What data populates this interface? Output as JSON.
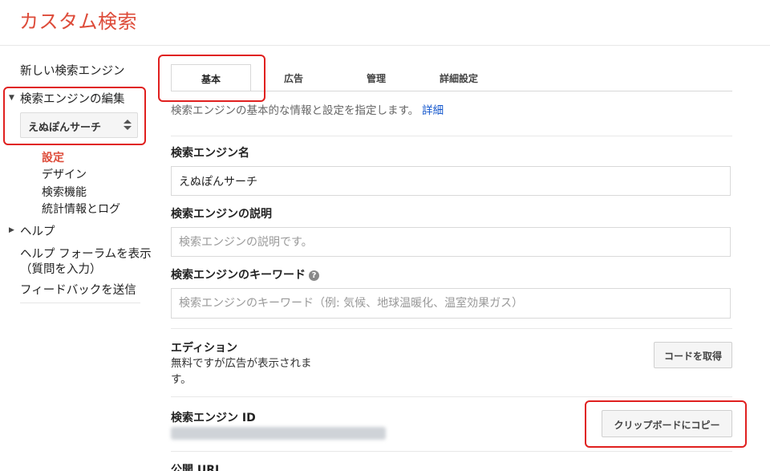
{
  "header": {
    "title": "カスタム検索"
  },
  "sidebar": {
    "new_engine": "新しい検索エンジン",
    "edit_engines": "検索エンジンの編集",
    "selected_engine": "えぬぽんサーチ",
    "sub_items": [
      "設定",
      "デザイン",
      "検索機能",
      "統計情報とログ"
    ],
    "help": "ヘルプ",
    "forum": "ヘルプ フォーラムを表示",
    "forum_note": "（質問を入力）",
    "feedback": "フィードバックを送信"
  },
  "tabs": [
    "基本",
    "広告",
    "管理",
    "詳細設定"
  ],
  "active_tab": "基本",
  "intro": {
    "text": "検索エンジンの基本的な情報と設定を指定します。",
    "link": "詳細"
  },
  "form": {
    "name_label": "検索エンジン名",
    "name_value": "えぬぽんサーチ",
    "desc_label": "検索エンジンの説明",
    "desc_placeholder": "検索エンジンの説明です。",
    "keywords_label": "検索エンジンのキーワード",
    "keywords_help_icon": "?",
    "keywords_placeholder": "検索エンジンのキーワード（例: 気候、地球温暖化、温室効果ガス）",
    "edition_label": "エディション",
    "edition_desc": "無料ですが広告が表示されます。",
    "get_code_button": "コードを取得",
    "id_label": "検索エンジン ID",
    "copy_button": "クリップボードにコピー",
    "public_url_label": "公開 URL"
  },
  "colors": {
    "title_red": "#dd4b39",
    "highlight_red": "#e0201f",
    "link_blue": "#1155cc"
  }
}
